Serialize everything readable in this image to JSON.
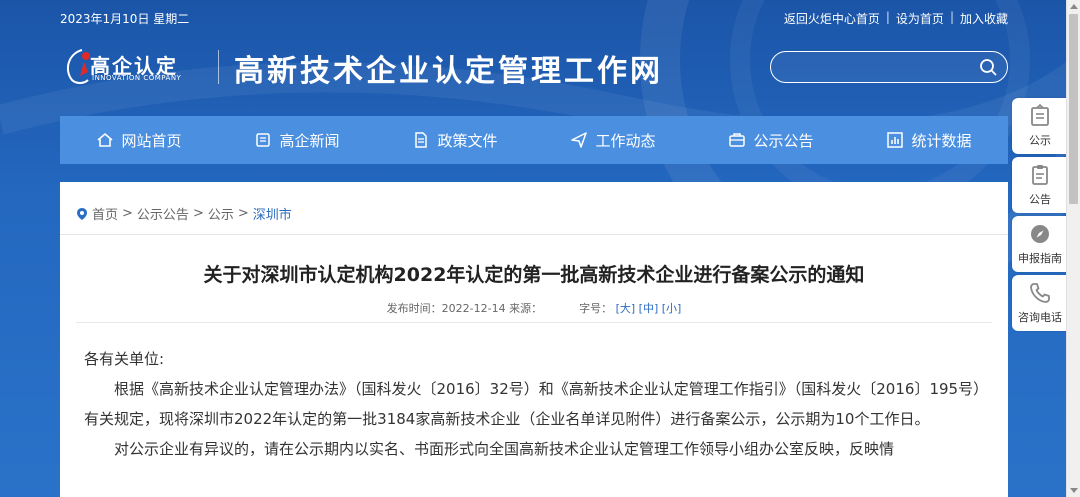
{
  "topbar": {
    "date": "2023年1月10日 星期二",
    "links": [
      "返回火炬中心首页",
      "设为首页",
      "加入收藏"
    ],
    "separator": "|"
  },
  "logo": {
    "cn": "高企认定",
    "en": "INNOVATION COMPANY"
  },
  "site_title": "高新技术企业认定管理工作网",
  "search": {
    "placeholder": ""
  },
  "nav": [
    {
      "label": "网站首页",
      "icon": "home-icon"
    },
    {
      "label": "高企新闻",
      "icon": "news-icon"
    },
    {
      "label": "政策文件",
      "icon": "document-icon"
    },
    {
      "label": "工作动态",
      "icon": "send-icon"
    },
    {
      "label": "公示公告",
      "icon": "briefcase-icon"
    },
    {
      "label": "统计数据",
      "icon": "chart-icon"
    }
  ],
  "breadcrumb": {
    "items": [
      "首页",
      "公示公告",
      "公示"
    ],
    "separator": ">",
    "current": "深圳市"
  },
  "article": {
    "title": "关于对深圳市认定机构2022年认定的第一批高新技术企业进行备案公示的通知",
    "meta_published": "发布时间：2022-12-14 来源：",
    "meta_font_label": "字号：",
    "font_sizes": [
      "[大]",
      "[中]",
      "[小]"
    ],
    "salutation": "各有关单位:",
    "paragraph1": "根据《高新技术企业认定管理办法》（国科发火〔2016〕32号）和《高新技术企业认定管理工作指引》（国科发火〔2016〕195号）有关规定，现将深圳市2022年认定的第一批3184家高新技术企业（企业名单详见附件）进行备案公示，公示期为10个工作日。",
    "paragraph2": "对公示企业有异议的，请在公示期内以实名、书面形式向全国高新技术企业认定管理工作领导小组办公室反映，反映情"
  },
  "side_tools": [
    {
      "label": "公示",
      "icon": "notice-board-icon"
    },
    {
      "label": "公告",
      "icon": "clipboard-icon"
    },
    {
      "label": "申报指南",
      "icon": "compass-icon"
    },
    {
      "label": "咨询电话",
      "icon": "phone-icon"
    }
  ],
  "colors": {
    "header_bg": "#1f61b5",
    "nav_bg": "#4b8fe0",
    "link": "#2c6dc4"
  }
}
